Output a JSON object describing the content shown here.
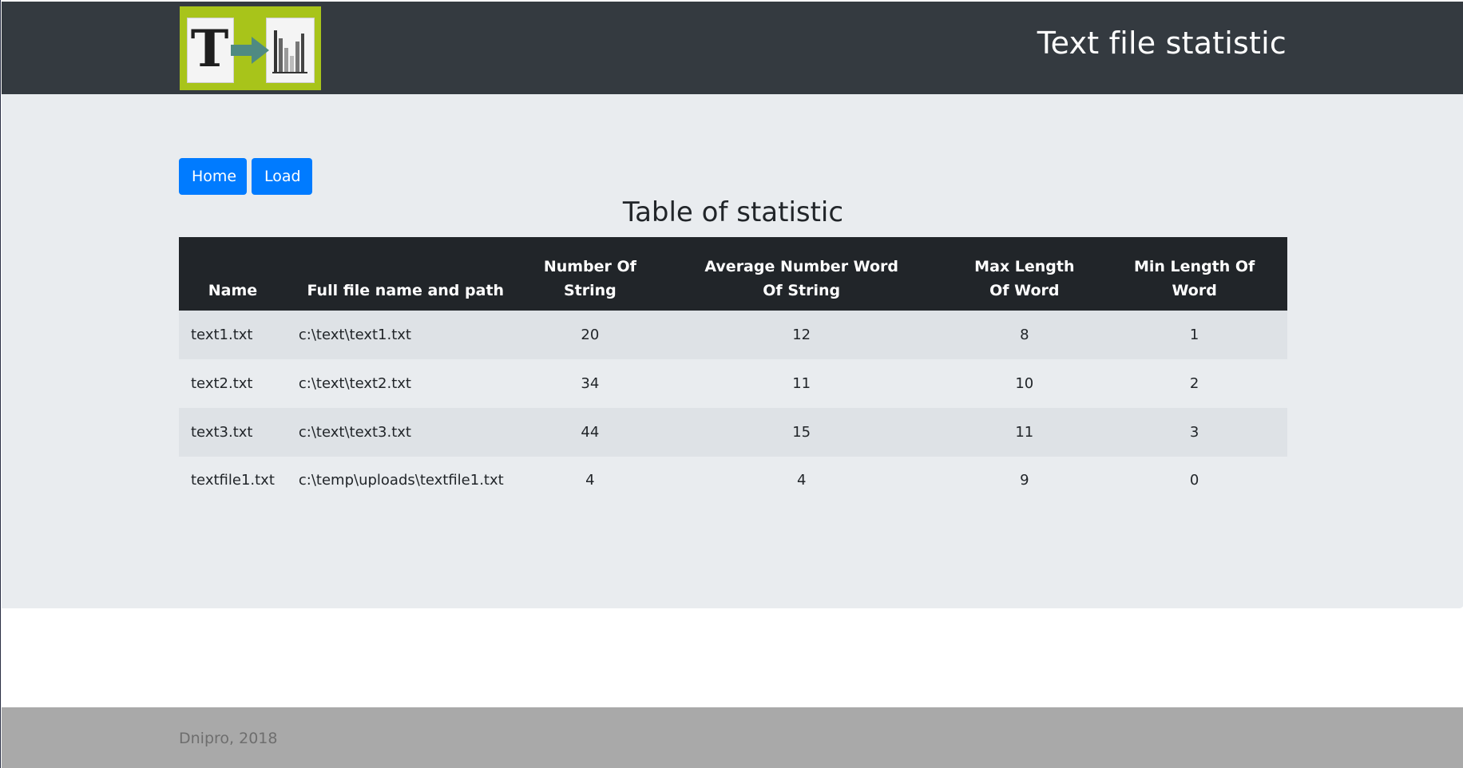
{
  "header": {
    "title": "Text file statistic",
    "logo_icon": "text-to-chart-logo"
  },
  "nav": {
    "home_label": "Home",
    "load_label": "Load"
  },
  "table": {
    "title": "Table of statistic",
    "columns": [
      "Name",
      "Full file name and path",
      "Number Of String",
      "Average Number Word Of String",
      "Max Length Of Word",
      "Min Length Of Word"
    ],
    "rows": [
      {
        "name": "text1.txt",
        "path": "c:\\text\\text1.txt",
        "strings": "20",
        "avg_words": "12",
        "max_len": "8",
        "min_len": "1"
      },
      {
        "name": "text2.txt",
        "path": "c:\\text\\text2.txt",
        "strings": "34",
        "avg_words": "11",
        "max_len": "10",
        "min_len": "2"
      },
      {
        "name": "text3.txt",
        "path": "c:\\text\\text3.txt",
        "strings": "44",
        "avg_words": "15",
        "max_len": "11",
        "min_len": "3"
      },
      {
        "name": "textfile1.txt",
        "path": "c:\\temp\\uploads\\textfile1.txt",
        "strings": "4",
        "avg_words": "4",
        "max_len": "9",
        "min_len": "0"
      }
    ]
  },
  "footer": {
    "text": "Dnipro, 2018"
  },
  "colors": {
    "header_bg": "#343a40",
    "main_bg": "#e9ecef",
    "button_bg": "#007bff",
    "table_head_bg": "#212529",
    "stripe_bg": "#dee2e6",
    "footer_bg": "#a9a9a9",
    "logo_bg": "#a8c41a"
  }
}
